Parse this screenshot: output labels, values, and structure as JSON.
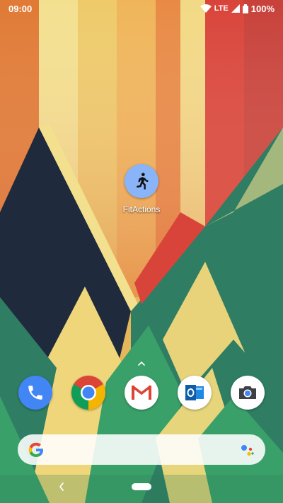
{
  "status_bar": {
    "time": "09:00",
    "network": "LTE",
    "battery": "100%"
  },
  "home": {
    "apps": [
      {
        "label": "FitActions",
        "icon": "running-person-icon",
        "color": "#8ab4f8"
      }
    ]
  },
  "dock": {
    "apps": [
      {
        "name": "Phone",
        "icon": "phone-icon"
      },
      {
        "name": "Chrome",
        "icon": "chrome-icon"
      },
      {
        "name": "Gmail",
        "icon": "gmail-icon"
      },
      {
        "name": "Outlook",
        "icon": "outlook-icon"
      },
      {
        "name": "Camera",
        "icon": "camera-icon"
      }
    ]
  },
  "search": {
    "left_icon": "google-g-icon",
    "right_icon": "google-assistant-icon"
  },
  "nav": {
    "back_icon": "back-chevron-icon",
    "home_icon": "home-pill-icon"
  },
  "colors": {
    "wallpaper_orange": "#e07a35",
    "wallpaper_yellow": "#f0d67a",
    "wallpaper_red": "#d9443a",
    "wallpaper_navy": "#1f2a3c",
    "wallpaper_teal": "#2f7d63",
    "wallpaper_green": "#3aa06a"
  }
}
